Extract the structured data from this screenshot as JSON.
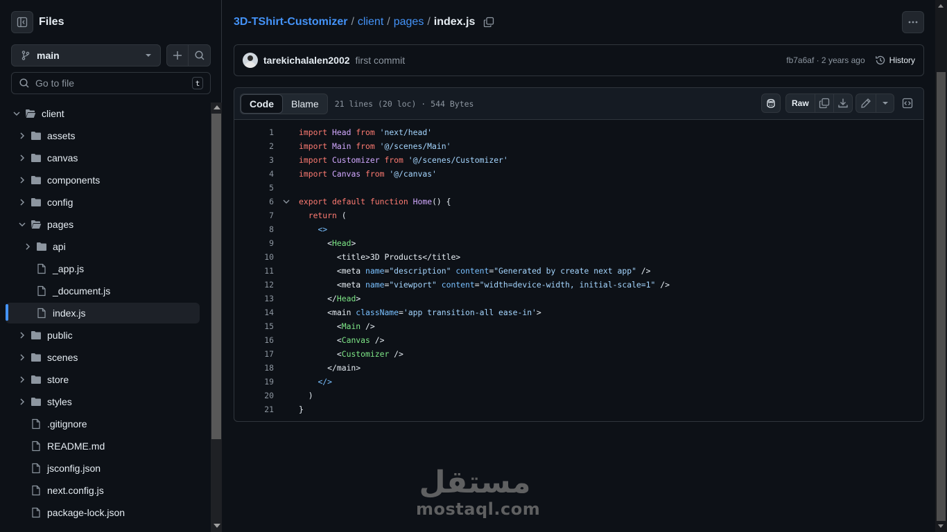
{
  "sidebar": {
    "title": "Files",
    "branch": "main",
    "goto_placeholder": "Go to file",
    "goto_shortcut": "t",
    "tree": [
      {
        "label": "client",
        "type": "folder",
        "depth": 0,
        "expanded": true
      },
      {
        "label": "assets",
        "type": "folder",
        "depth": 1,
        "expanded": false
      },
      {
        "label": "canvas",
        "type": "folder",
        "depth": 1,
        "expanded": false
      },
      {
        "label": "components",
        "type": "folder",
        "depth": 1,
        "expanded": false
      },
      {
        "label": "config",
        "type": "folder",
        "depth": 1,
        "expanded": false
      },
      {
        "label": "pages",
        "type": "folder",
        "depth": 1,
        "expanded": true
      },
      {
        "label": "api",
        "type": "folder",
        "depth": 2,
        "expanded": false
      },
      {
        "label": "_app.js",
        "type": "file",
        "depth": 2
      },
      {
        "label": "_document.js",
        "type": "file",
        "depth": 2
      },
      {
        "label": "index.js",
        "type": "file",
        "depth": 2,
        "selected": true
      },
      {
        "label": "public",
        "type": "folder",
        "depth": 1,
        "expanded": false
      },
      {
        "label": "scenes",
        "type": "folder",
        "depth": 1,
        "expanded": false
      },
      {
        "label": "store",
        "type": "folder",
        "depth": 1,
        "expanded": false
      },
      {
        "label": "styles",
        "type": "folder",
        "depth": 1,
        "expanded": false
      },
      {
        "label": ".gitignore",
        "type": "file",
        "depth": 1
      },
      {
        "label": "README.md",
        "type": "file",
        "depth": 1
      },
      {
        "label": "jsconfig.json",
        "type": "file",
        "depth": 1
      },
      {
        "label": "next.config.js",
        "type": "file",
        "depth": 1
      },
      {
        "label": "package-lock.json",
        "type": "file",
        "depth": 1
      }
    ]
  },
  "breadcrumb": {
    "repo": "3D-TShirt-Customizer",
    "parts": [
      "client",
      "pages"
    ],
    "current": "index.js"
  },
  "commit": {
    "author": "tarekichalalen2002",
    "message": "first commit",
    "hash_age": "fb7a6af · 2 years ago",
    "history_label": "History"
  },
  "file": {
    "tab_code": "Code",
    "tab_blame": "Blame",
    "info": "21 lines (20 loc) · 544 Bytes",
    "raw_label": "Raw",
    "lines": [
      "import Head from 'next/head'",
      "import Main from '@/scenes/Main'",
      "import Customizer from '@/scenes/Customizer'",
      "import Canvas from '@/canvas'",
      "",
      "export default function Home() {",
      "  return (",
      "    <>",
      "      <Head>",
      "        <title>3D Products</title>",
      "        <meta name=\"description\" content=\"Generated by create next app\" />",
      "        <meta name=\"viewport\" content=\"width=device-width, initial-scale=1\" />",
      "      </Head>",
      "      <main className='app transition-all ease-in'>",
      "        <Main />",
      "        <Canvas />",
      "        <Customizer />",
      "      </main>",
      "    </>",
      "  )",
      "}"
    ]
  },
  "watermark": {
    "arabic": "مستقل",
    "latin": "mostaql.com"
  },
  "colors": {
    "background": "#0d1117",
    "link": "#4493f8",
    "keyword": "#ff7b72",
    "string": "#a5d6ff",
    "function": "#d2a8ff",
    "tag": "#7ee787",
    "attr": "#79c0ff",
    "selected_indicator": "#4493f8"
  }
}
